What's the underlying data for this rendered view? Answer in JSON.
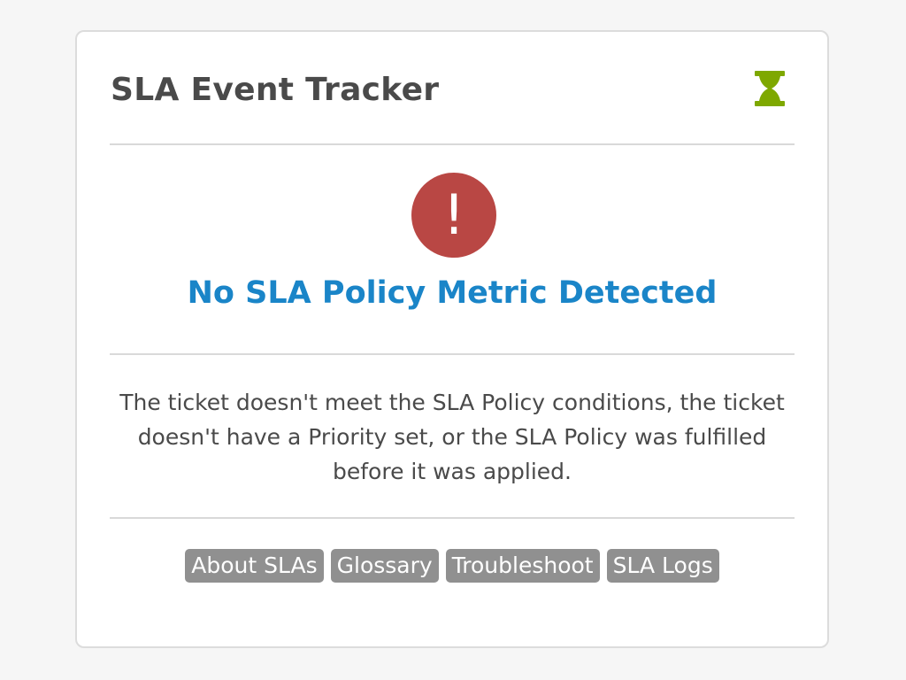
{
  "widget": {
    "title": "SLA Event Tracker",
    "header_icon": "hourglass-icon",
    "accent_color": "#7ea800"
  },
  "status": {
    "icon": "exclamation-icon",
    "icon_glyph": "!",
    "icon_color": "#b94744",
    "title": "No SLA Policy Metric Detected",
    "title_color": "#1a85c8"
  },
  "description": "The ticket doesn't meet the SLA Policy conditions, the ticket doesn't have a Priority set, or the SLA Policy was fulfilled before it was applied.",
  "links": [
    {
      "label": "About SLAs"
    },
    {
      "label": "Glossary"
    },
    {
      "label": "Troubleshoot"
    },
    {
      "label": "SLA Logs"
    }
  ]
}
